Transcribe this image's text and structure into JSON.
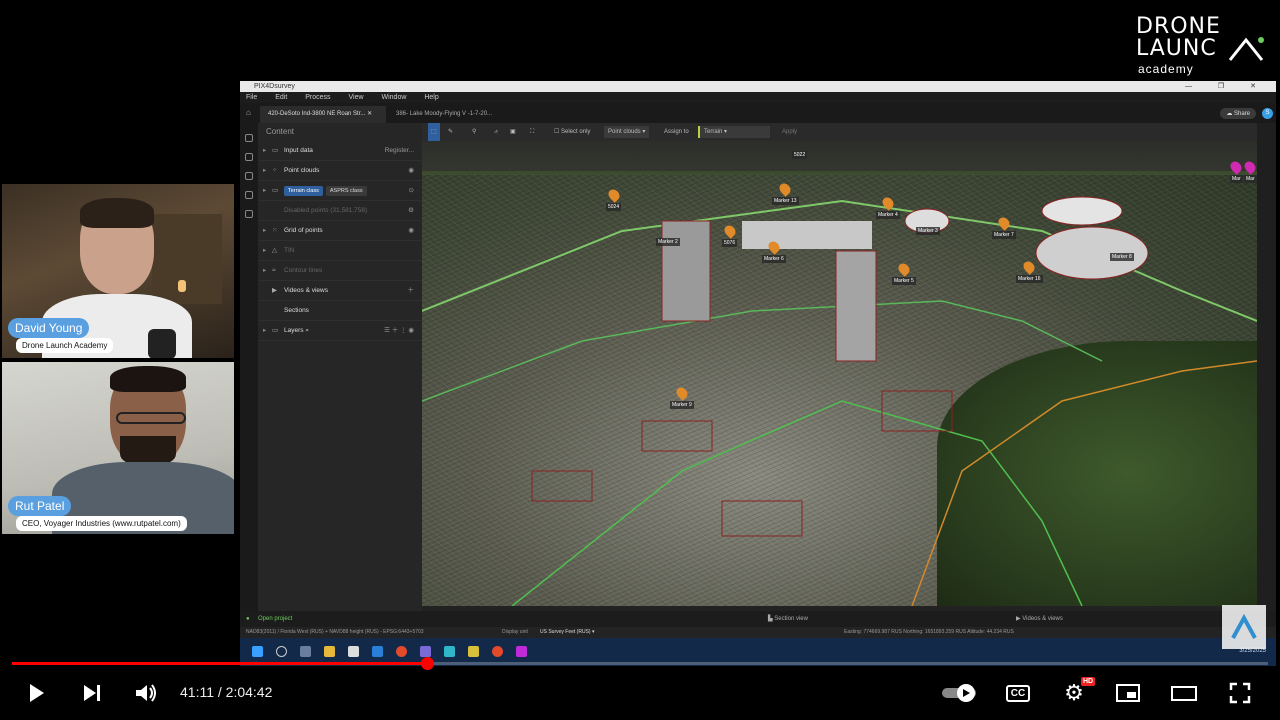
{
  "brand": {
    "line1": "DRONE",
    "line2": "LAUNC",
    "line3": "academy"
  },
  "participants": [
    {
      "name": "David Young",
      "subtitle": "Drone Launch Academy"
    },
    {
      "name": "Rut Patel",
      "subtitle": "CEO, Voyager Industries (www.rutpatel.com)"
    }
  ],
  "app": {
    "title": "PIX4Dsurvey",
    "menu": [
      "File",
      "Edit",
      "Process",
      "View",
      "Window",
      "Help"
    ],
    "tabs": [
      "420-DeSoto Ind-3800 NE Roan Str...",
      "386- Lake Moody-Flying V -1-7-20..."
    ],
    "share_label": "Share",
    "avatar_letter": "S",
    "panel": {
      "title": "Content",
      "rows": [
        {
          "label": "Input data",
          "right": "Register..."
        },
        {
          "label": "Point clouds",
          "right": ""
        },
        {
          "label": "",
          "right": ""
        },
        {
          "label": "Disabled points (31,581,758)",
          "right": ""
        },
        {
          "label": "Grid of points",
          "right": ""
        },
        {
          "label": "TIN",
          "right": ""
        },
        {
          "label": "Contour lines",
          "right": ""
        },
        {
          "label": "Videos & views",
          "right": ""
        },
        {
          "label": "Sections",
          "right": ""
        },
        {
          "label": "Layers",
          "right": ""
        }
      ],
      "chips": [
        "Terrain class",
        "ASPRS class"
      ]
    },
    "toolbar": {
      "select_only": "Select only",
      "point_clouds": "Point clouds",
      "assign_to": "Assign to",
      "terrain": "Terrain",
      "apply": "Apply"
    },
    "markers": [
      {
        "label": "5022"
      },
      {
        "label": "5024"
      },
      {
        "label": "Marker 13"
      },
      {
        "label": "Marker 2"
      },
      {
        "label": "5076"
      },
      {
        "label": "Marker 6"
      },
      {
        "label": "Marker 4"
      },
      {
        "label": "Marker 3"
      },
      {
        "label": "Marker 7"
      },
      {
        "label": "Marker 5"
      },
      {
        "label": "Marker 8"
      },
      {
        "label": "Marker 16"
      },
      {
        "label": "Marker 9"
      },
      {
        "label": "Mar"
      },
      {
        "label": "Mar"
      }
    ],
    "bottombar": {
      "open_project": "Open project",
      "section_view": "Section view",
      "videos_views": "Videos & views"
    },
    "status": {
      "left": "NAD83(2011) / Florida West (RUS) + NAVD88 height (RUS) - EPSG:6443+5703",
      "display_unit_label": "Display unit",
      "display_unit": "US Survey Feet (RUS)",
      "coords": "Easting: 774669.987 RUS  Northing: 1651893.259 RUS  Altitude: 44.234 RUS"
    },
    "clock": "3/25/2025"
  },
  "player": {
    "current_time": "41:11",
    "separator": "/",
    "duration": "2:04:42",
    "progress": 0.3302,
    "hd_badge": "HD",
    "cc_label": "CC",
    "colors": {
      "progress": "#ff0000",
      "name_tag": "#5aa0e0"
    }
  }
}
